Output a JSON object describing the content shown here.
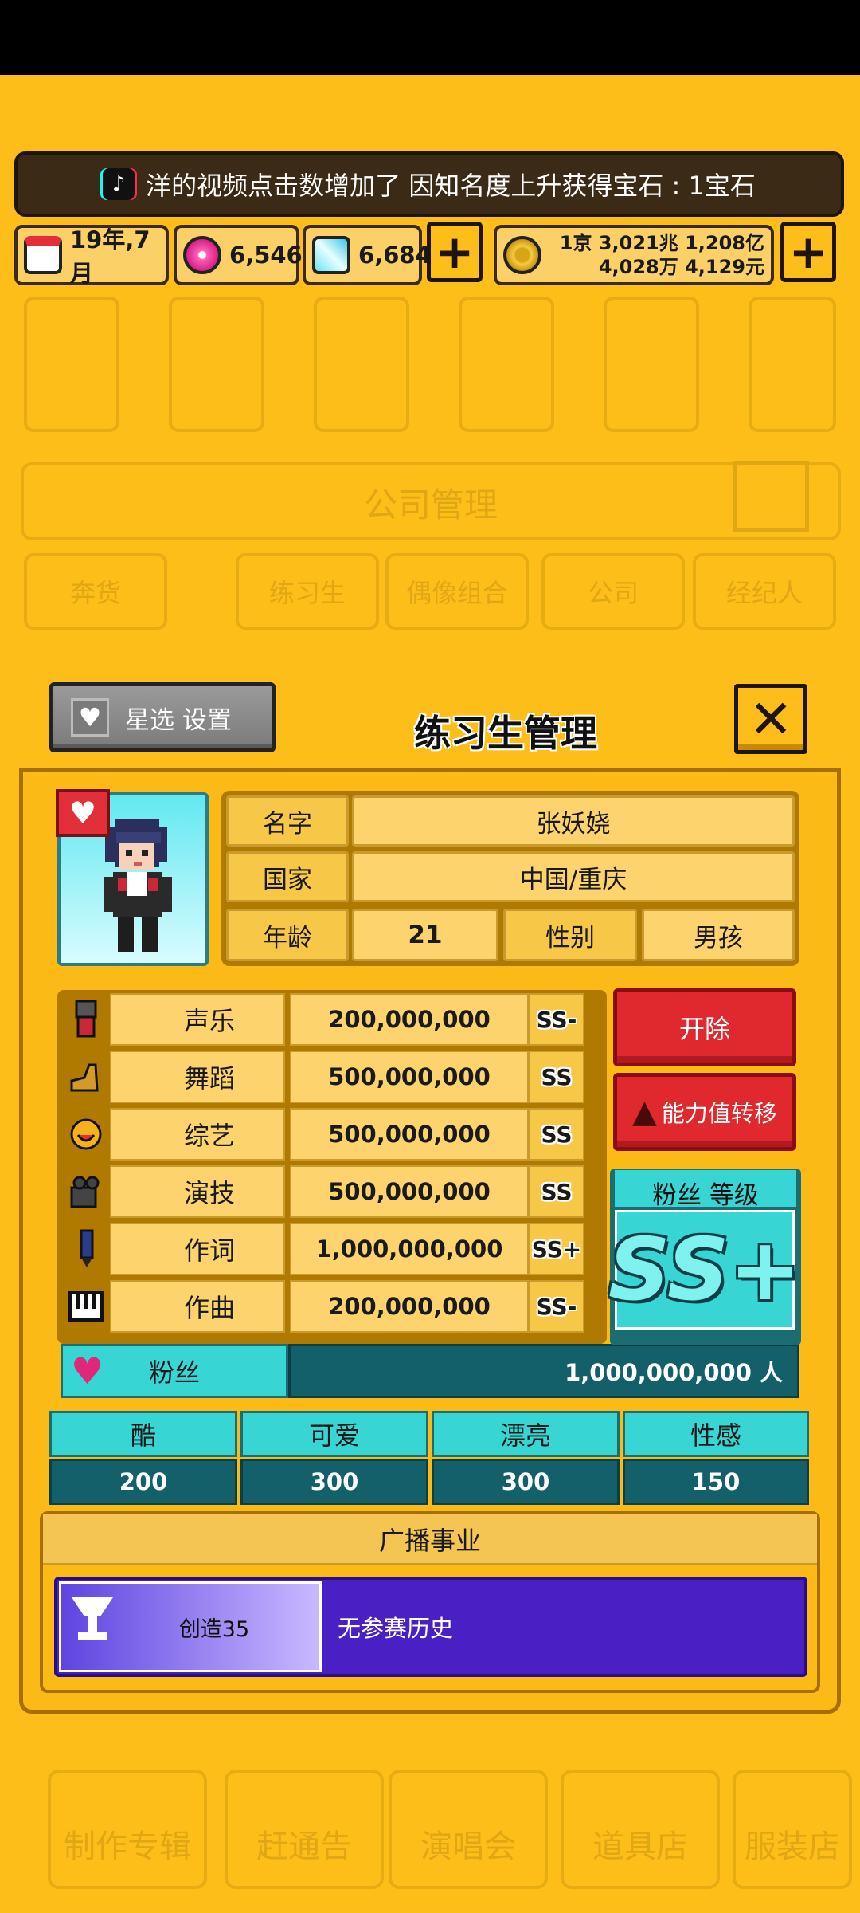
{
  "notification": {
    "text": "洋的视频点击数增加了 因知名度上升获得宝石 : 1宝石"
  },
  "resources": {
    "date": "19年,7月",
    "pink_gems": "6,546",
    "blue_gems": "6,684",
    "money_line1": "1京 3,021兆 1,208亿",
    "money_line2": "4,028万 4,129元",
    "plus_label": "+"
  },
  "background_menu": {
    "title": "公司管理",
    "tabs": [
      "奔货",
      "练习生",
      "偶像组合",
      "公司",
      "经纪人"
    ],
    "bottom": [
      "制作专辑",
      "赶通告",
      "演唱会",
      "道具店",
      "服装店"
    ]
  },
  "panel": {
    "title": "练习生管理",
    "star_button": "星选 设置",
    "close": "✕"
  },
  "trainee": {
    "name_label": "名字",
    "name": "张妖娆",
    "country_label": "国家",
    "country": "中国/重庆",
    "age_label": "年龄",
    "age": "21",
    "gender_label": "性别",
    "gender": "男孩"
  },
  "stats": [
    {
      "name": "声乐",
      "value": "200,000,000",
      "grade": "SS-",
      "icon": "microphone-icon"
    },
    {
      "name": "舞蹈",
      "value": "500,000,000",
      "grade": "SS",
      "icon": "shoe-icon"
    },
    {
      "name": "综艺",
      "value": "500,000,000",
      "grade": "SS",
      "icon": "smile-icon"
    },
    {
      "name": "演技",
      "value": "500,000,000",
      "grade": "SS",
      "icon": "camera-icon"
    },
    {
      "name": "作词",
      "value": "1,000,000,000",
      "grade": "SS+",
      "icon": "pen-icon"
    },
    {
      "name": "作曲",
      "value": "200,000,000",
      "grade": "SS-",
      "icon": "piano-icon"
    }
  ],
  "fans": {
    "label": "粉丝",
    "value": "1,000,000,000 人"
  },
  "buttons": {
    "fire": "开除",
    "transfer": "能力值转移"
  },
  "fan_level": {
    "label": "粉丝 等级",
    "grade": "SS+"
  },
  "attributes": [
    {
      "name": "酷",
      "value": "200"
    },
    {
      "name": "可爱",
      "value": "300"
    },
    {
      "name": "漂亮",
      "value": "300"
    },
    {
      "name": "性感",
      "value": "150"
    }
  ],
  "broadcast": {
    "title": "广播事业",
    "tag": "创造35",
    "history": "无参赛历史"
  },
  "colors": {
    "gold": "#FDBE1A",
    "teal": "#37d5d3",
    "red": "#e0282f",
    "purple": "#4a1fc3"
  }
}
